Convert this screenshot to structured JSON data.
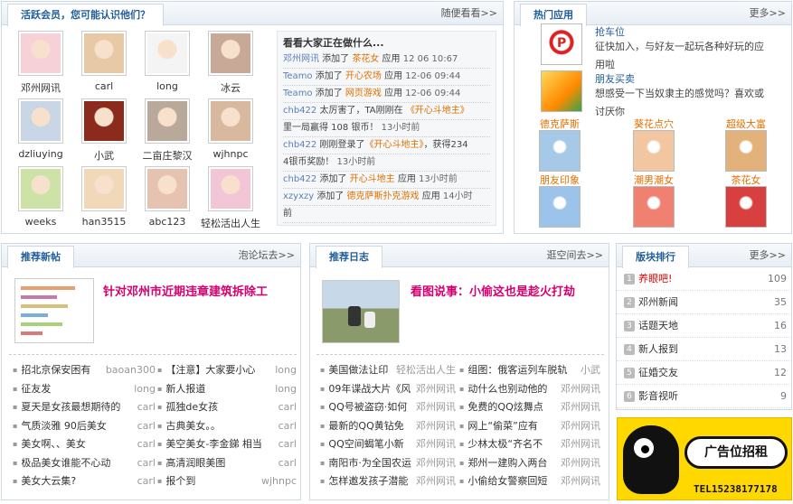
{
  "members": {
    "title": "活跃会员，您可能认识他们？",
    "more": "随便看看>>",
    "users": [
      "邓州网讯",
      "carl",
      "long",
      "冰云",
      "dzliuying",
      "小武",
      "二亩庄黎汉",
      "wjhnpc",
      "weeks",
      "han3515",
      "abc123",
      "轻松活出人生"
    ],
    "feed_title": "看看大家正在做什么...",
    "feed": [
      {
        "user": "邓州网讯",
        "act": " 添加了 ",
        "target": "茶花女",
        "suffix": " 应用",
        "time": "12 06 10:67"
      },
      {
        "user": "Teamo",
        "act": " 添加了 ",
        "target": "开心农场",
        "suffix": " 应用",
        "time": "12-06 09:44"
      },
      {
        "user": "Teamo",
        "act": " 添加了 ",
        "target": "网页游戏",
        "suffix": " 应用",
        "time": "12-06 09:44"
      },
      {
        "user": "chb422",
        "act": " 太厉害了，TA刚刚在 ",
        "target": "《开心斗地主》",
        "suffix": "",
        "time": ""
      },
      {
        "user": "",
        "act": "里一局赢得 108 银币！ ",
        "target": "",
        "suffix": "",
        "time": "13小时前"
      },
      {
        "user": "chb422",
        "act": " 刚刚登录了",
        "target": "《开心斗地主》",
        "suffix": "，获得234",
        "time": ""
      },
      {
        "user": "",
        "act": "4银币奖励！ ",
        "target": "",
        "suffix": "",
        "time": "13小时前"
      },
      {
        "user": "chb422",
        "act": " 添加了 ",
        "target": "开心斗地主",
        "suffix": " 应用",
        "time": "13小时前"
      },
      {
        "user": "xzyxzy",
        "act": " 添加了 ",
        "target": "德克萨斯扑克游戏",
        "suffix": " 应用",
        "time": "14小时"
      },
      {
        "user": "",
        "act": "前",
        "target": "",
        "suffix": "",
        "time": ""
      }
    ]
  },
  "apps": {
    "title": "热门应用",
    "more": "更多>>",
    "featured": [
      {
        "name": "抢车位",
        "desc1": "征快加入，与好友一起玩各种好玩的应",
        "desc2": "用啦"
      },
      {
        "name": "朋友买卖",
        "desc1": "想感受一下当奴隶主的感觉吗？喜欢或",
        "desc2": "讨厌你"
      }
    ],
    "grid": [
      "德克萨斯",
      "葵花点穴",
      "超级大富",
      "朋友印象",
      "潮男潮女",
      "茶花女"
    ]
  },
  "posts": {
    "title": "推荐新帖",
    "more": "泡论坛去>>",
    "headline": "针对邓州市近期违章建筑拆除工",
    "left": [
      {
        "t": "招北京保安困有",
        "a": "baoan300"
      },
      {
        "t": "征友发",
        "a": "long"
      },
      {
        "t": "夏天是女孩最想期待的",
        "a": "carl"
      },
      {
        "t": "气质淡雅 90后美女",
        "a": "carl"
      },
      {
        "t": "美女啊、、美女",
        "a": "carl"
      },
      {
        "t": "极品美女谁能不心动",
        "a": "carl"
      },
      {
        "t": "美女大云集?",
        "a": "carl"
      }
    ],
    "right": [
      {
        "t": "【注意】大家要小心",
        "a": "long"
      },
      {
        "t": "新人报道",
        "a": "long"
      },
      {
        "t": "孤独de女孩",
        "a": "carl"
      },
      {
        "t": "古典美女。。",
        "a": "carl"
      },
      {
        "t": "美空美女-李金銻 相当",
        "a": "carl"
      },
      {
        "t": "高清润眼美图",
        "a": "carl"
      },
      {
        "t": "报个到",
        "a": "wjhnpc"
      }
    ]
  },
  "blogs": {
    "title": "推荐日志",
    "more": "逛空间去>>",
    "headline": "看图说事：小偷这也是趁火打劫",
    "left": [
      {
        "t": "美国做法让印",
        "a": "轻松活出人生"
      },
      {
        "t": "09年谍战大片《风",
        "a": "邓州网讯"
      },
      {
        "t": "QQ号被盗窃·如何",
        "a": "邓州网讯"
      },
      {
        "t": "最新的QQ黄钻免",
        "a": "邓州网讯"
      },
      {
        "t": "QQ空间蝎笔小新",
        "a": "邓州网讯"
      },
      {
        "t": "南阳市·为全国农运",
        "a": "邓州网讯"
      },
      {
        "t": "怎样邀发孩子潜能",
        "a": "邓州网讯"
      }
    ],
    "right": [
      {
        "t": "组图：俄客运列车脱轨",
        "a": "小武"
      },
      {
        "t": "动什么也别动他的",
        "a": "邓州网讯"
      },
      {
        "t": "免费的QQ炫舞点",
        "a": "邓州网讯"
      },
      {
        "t": "网上“偷菜”应有",
        "a": "邓州网讯"
      },
      {
        "t": "少林太极“齐名不",
        "a": "邓州网讯"
      },
      {
        "t": "郑州一建购入两台",
        "a": "邓州网讯"
      },
      {
        "t": "小偷给女警察回短",
        "a": "邓州网讯"
      }
    ]
  },
  "ranking": {
    "title": "版块排行",
    "more": "更多>>",
    "items": [
      {
        "n": "1",
        "name": "养眼吧!",
        "count": "109",
        "hot": true
      },
      {
        "n": "2",
        "name": "邓州新闻",
        "count": "35"
      },
      {
        "n": "3",
        "name": "话题天地",
        "count": "16"
      },
      {
        "n": "4",
        "name": "新人报到",
        "count": "13"
      },
      {
        "n": "5",
        "name": "征婚交友",
        "count": "12"
      },
      {
        "n": "6",
        "name": "影音视听",
        "count": "9"
      }
    ]
  },
  "ad": {
    "text": "广告位招租",
    "tel": "TEL15238177178"
  },
  "colors": {
    "accent": "#1f5d9b",
    "pink": "#d4006f",
    "orange": "#e07000"
  }
}
